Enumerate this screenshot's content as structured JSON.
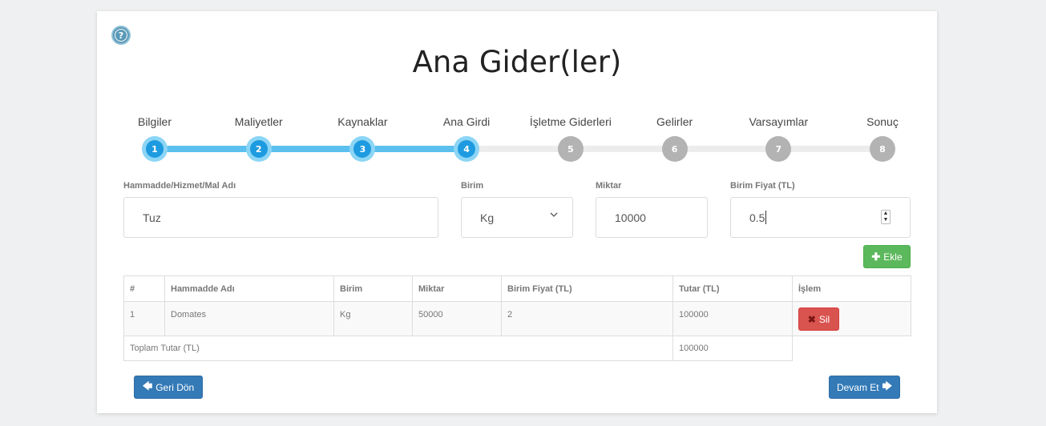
{
  "page": {
    "title": "Ana Gider(ler)",
    "help_icon_glyph": "?"
  },
  "stepper": {
    "current_step": 4,
    "steps": [
      {
        "label": "Bilgiler",
        "number": "1",
        "state": "active"
      },
      {
        "label": "Maliyetler",
        "number": "2",
        "state": "active"
      },
      {
        "label": "Kaynaklar",
        "number": "3",
        "state": "active"
      },
      {
        "label": "Ana Girdi",
        "number": "4",
        "state": "active"
      },
      {
        "label": "İşletme Giderleri",
        "number": "5",
        "state": "inactive"
      },
      {
        "label": "Gelirler",
        "number": "6",
        "state": "inactive"
      },
      {
        "label": "Varsayımlar",
        "number": "7",
        "state": "inactive"
      },
      {
        "label": "Sonuç",
        "number": "8",
        "state": "inactive"
      }
    ]
  },
  "form": {
    "name_label": "Hammadde/Hizmet/Mal Adı",
    "name_value": "Tuz",
    "unit_label": "Birim",
    "unit_value": "Kg",
    "quantity_label": "Miktar",
    "quantity_value": "10000",
    "price_label": "Birim Fiyat (TL)",
    "price_value": "0.5",
    "add_button": "Ekle"
  },
  "table": {
    "headers": [
      "#",
      "Hammadde Adı",
      "Birim",
      "Miktar",
      "Birim Fiyat (TL)",
      "Tutar (TL)",
      "İşlem"
    ],
    "rows": [
      {
        "index": "1",
        "name": "Domates",
        "unit": "Kg",
        "quantity": "50000",
        "unit_price": "2",
        "total": "100000",
        "action": "Sil"
      }
    ],
    "total_label": "Toplam Tutar (TL)",
    "total_value": "100000"
  },
  "nav": {
    "back_button": "Geri Dön",
    "next_button": "Devam Et"
  },
  "colors": {
    "step_active": "#1e9be0",
    "step_inactive": "#b3b3b3",
    "add_button": "#5cb85c",
    "delete_button": "#d9534f",
    "nav_button": "#337ab7"
  }
}
